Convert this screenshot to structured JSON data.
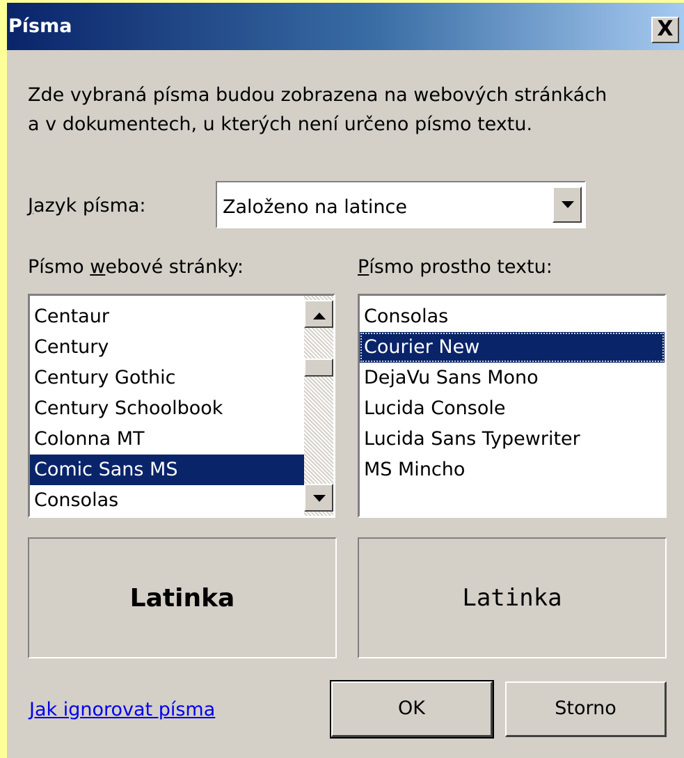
{
  "dialog": {
    "title": "Písma",
    "close_label": "X"
  },
  "description": {
    "line1": "Zde vybraná písma budou zobrazena na webových stránkách",
    "line2": "a v dokumentech, u kterých není určeno písmo textu."
  },
  "language": {
    "label_accel": "J",
    "label_rest": "azyk písma:",
    "value": "Založeno na latince"
  },
  "web_font": {
    "label_pre": "Písmo ",
    "label_accel": "w",
    "label_post": "ebové stránky:",
    "items": [
      "Centaur",
      "Century",
      "Century Gothic",
      "Century Schoolbook",
      "Colonna MT",
      "Comic Sans MS",
      "Consolas"
    ],
    "selected": "Comic Sans MS",
    "preview": "Latinka"
  },
  "plain_font": {
    "label_accel": "P",
    "label_rest": "ísmo prostho textu:",
    "items": [
      "Consolas",
      "Courier New",
      "DejaVu Sans Mono",
      "Lucida Console",
      "Lucida Sans Typewriter",
      "MS Mincho"
    ],
    "selected": "Courier New",
    "preview": "Latinka"
  },
  "footer": {
    "link": "Jak ignorovat písma",
    "ok_label": "OK",
    "cancel_label": "Storno"
  },
  "colors": {
    "titlebar_start": "#0a246a",
    "titlebar_end": "#a6caf0",
    "selection": "#0a246a",
    "face": "#d4d0c8",
    "highlight_edge": "#ffff99"
  }
}
